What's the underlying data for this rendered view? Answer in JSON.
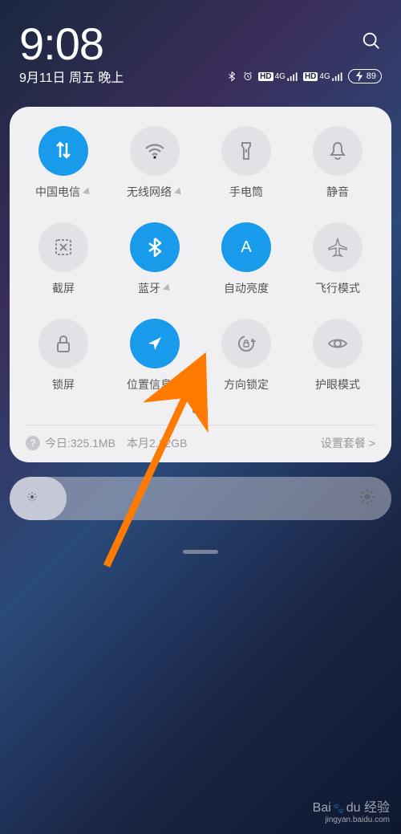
{
  "header": {
    "time": "9:08",
    "date": "9月11日 周五 晚上",
    "battery": "89"
  },
  "tiles": [
    {
      "id": "mobile-data",
      "label": "中国电信",
      "active": true,
      "expandable": true
    },
    {
      "id": "wifi",
      "label": "无线网络",
      "active": false,
      "expandable": true
    },
    {
      "id": "flashlight",
      "label": "手电筒",
      "active": false,
      "expandable": false
    },
    {
      "id": "silent",
      "label": "静音",
      "active": false,
      "expandable": false
    },
    {
      "id": "screenshot",
      "label": "截屏",
      "active": false,
      "expandable": false
    },
    {
      "id": "bluetooth",
      "label": "蓝牙",
      "active": true,
      "expandable": true
    },
    {
      "id": "auto-brightness",
      "label": "自动亮度",
      "active": true,
      "expandable": false
    },
    {
      "id": "airplane",
      "label": "飞行模式",
      "active": false,
      "expandable": false
    },
    {
      "id": "lock",
      "label": "锁屏",
      "active": false,
      "expandable": false
    },
    {
      "id": "location",
      "label": "位置信息",
      "active": true,
      "expandable": true
    },
    {
      "id": "rotation-lock",
      "label": "方向锁定",
      "active": false,
      "expandable": false
    },
    {
      "id": "eye-care",
      "label": "护眼模式",
      "active": false,
      "expandable": false
    }
  ],
  "data_usage": {
    "today_label": "今日:",
    "today_value": "325.1MB",
    "month_label": "本月",
    "month_value": "2.12GB",
    "plan_label": "设置套餐 >"
  },
  "watermark": {
    "brand": "Baidu 经验",
    "url": "jingyan.baidu.com"
  },
  "icons": {
    "mobile-data": "<path d='M10 4 L10 22 M6 8 L10 4 L14 8 M18 4 L18 22 M14 18 L18 22 L22 18' stroke-width='2.5' fill='none'/>",
    "wifi": "<path d='M3 11 C9 5 19 5 25 11 M7 15 C11 11 17 11 21 15 M11 19 C13 17 15 17 17 19' stroke-width='2.2' fill='none'/><circle cx='14' cy='22' r='1.5'/>",
    "flashlight": "<path d='M9 4 L19 4 L19 8 L17 11 L17 24 L11 24 L11 11 L9 8 Z M14 12 L14 16' stroke-width='2' fill='none'/>",
    "silent": "<path d='M14 4 C10 4 9 7 9 11 L9 15 L6 19 L22 19 L19 15 L19 11 C19 7 18 4 14 4 Z M11 22 C11 23 12 24 14 24 C16 24 17 23 17 22' stroke-width='2' fill='none'/>",
    "screenshot": "<rect x='5' y='5' width='18' height='18' rx='2' stroke-width='2' fill='none' stroke-dasharray='3,2'/><path d='M10 10 L18 18 M18 10 L10 18' stroke-width='2'/>",
    "bluetooth": "<path d='M14 3 L14 25 L21 19 L7 9 M14 3 L21 9 L7 19' stroke-width='2.5' fill='none' stroke-linejoin='round'/>",
    "auto-brightness": "<text x='14' y='20' font-size='20' text-anchor='middle' font-family='sans-serif' stroke='none'>A</text>",
    "airplane": "<path d='M14 3 L16 11 L25 15 L25 17 L16 15 L16 22 L19 25 L14 24 L9 25 L12 22 L12 15 L3 17 L3 15 L12 11 Z' stroke-width='1.5' fill='none'/>",
    "lock": "<rect x='7' y='13' width='14' height='11' rx='2' stroke-width='2' fill='none'/><path d='M10 13 L10 9 C10 6 12 5 14 5 C16 5 18 6 18 9 L18 13' stroke-width='2' fill='none'/>",
    "location": "<path d='M22 6 L6 14 L13 15 L14 22 Z' stroke-width='0'/>",
    "rotation-lock": "<circle cx='14' cy='14' r='9' stroke-width='2' fill='none' stroke-dasharray='40,10'/><path d='M22 9 L24 11 L20 11' stroke-width='2' fill='none'/><rect x='11' y='13' width='6' height='5' rx='1' stroke-width='1.5' fill='none'/><path d='M12 13 L12 11 C12 10 13 10 14 10 C15 10 16 10 16 11 L16 13' stroke-width='1.5' fill='none'/>",
    "eye-care": "<path d='M3 14 C7 8 21 8 25 14 C21 20 7 20 3 14 Z' stroke-width='2' fill='none'/><circle cx='14' cy='14' r='4' stroke-width='2' fill='none'/>"
  }
}
